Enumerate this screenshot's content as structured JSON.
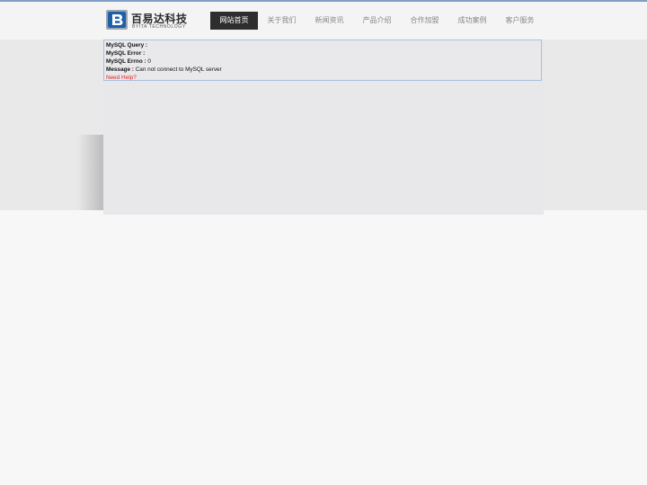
{
  "brand": {
    "name_cn": "百易达科技",
    "name_en": "BYITA TECHNOLOGY"
  },
  "nav": {
    "items": [
      {
        "label": "网站首页",
        "active": true
      },
      {
        "label": "关于我们",
        "active": false
      },
      {
        "label": "新闻资讯",
        "active": false
      },
      {
        "label": "产品介绍",
        "active": false
      },
      {
        "label": "合作加盟",
        "active": false
      },
      {
        "label": "成功案例",
        "active": false
      },
      {
        "label": "客户服务",
        "active": false
      }
    ]
  },
  "error": {
    "query_label": "MySQL Query :",
    "query_value": "",
    "error_label": "MySQL Error :",
    "error_value": "",
    "errno_label": "MySQL Errno :",
    "errno_value": "0",
    "message_label": "Message :",
    "message_value": "Can not connect to MySQL server",
    "help_label": "Need Help?"
  },
  "colors": {
    "accent_line": "#7f9fc7",
    "nav_active_bg": "#2e2e2e",
    "error_border": "#a9c0e0",
    "help_link": "#e02020",
    "logo_blue": "#1f5fa8"
  }
}
